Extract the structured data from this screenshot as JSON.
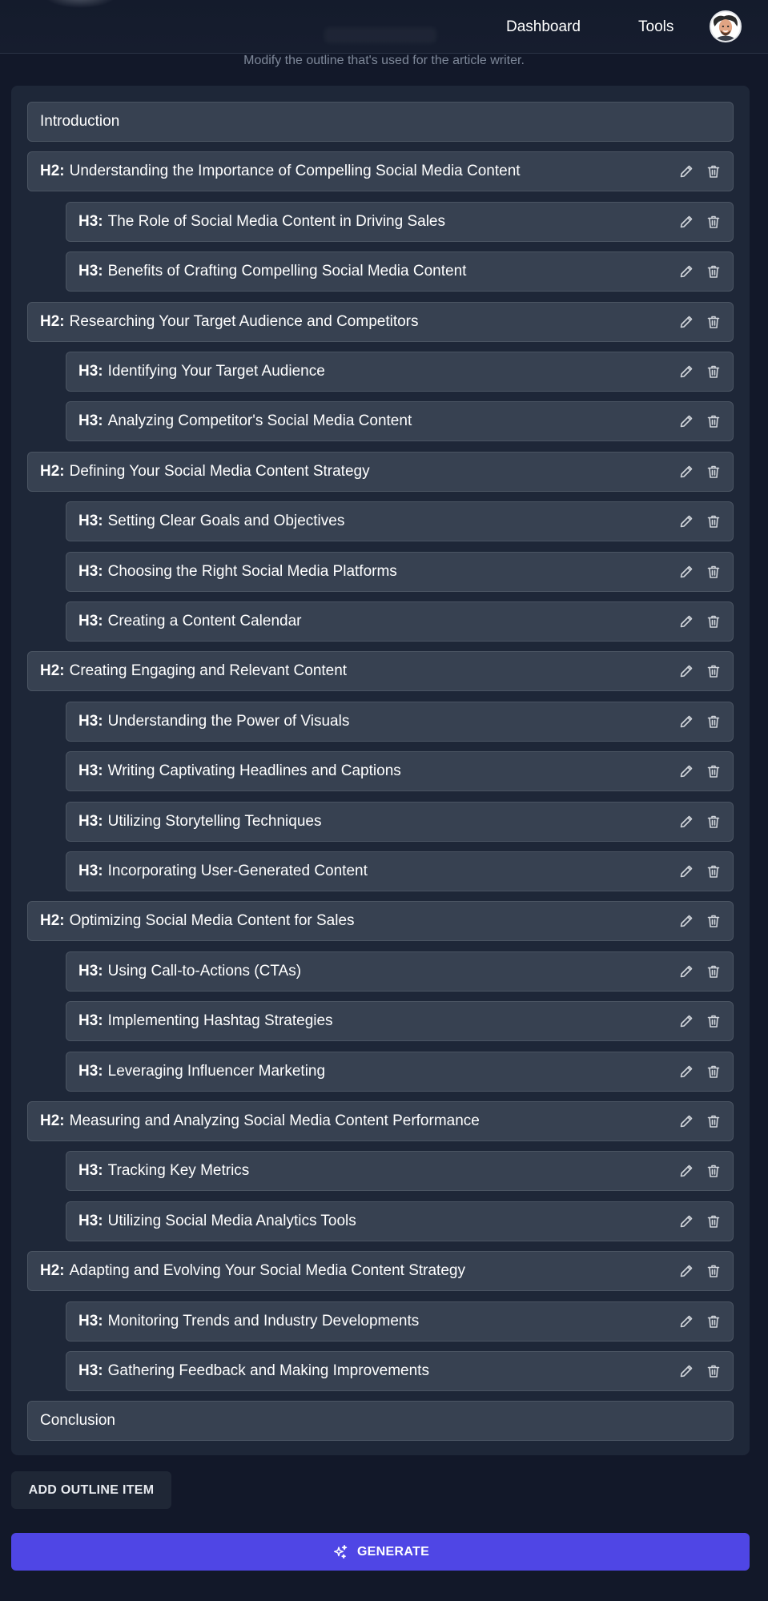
{
  "nav": {
    "dashboard_label": "Dashboard",
    "tools_label": "Tools"
  },
  "page": {
    "subtitle": "Modify the outline that's used for the article writer."
  },
  "outline": [
    {
      "level": "plain",
      "tag": "",
      "text": "Introduction"
    },
    {
      "level": "h2",
      "tag": "H2:",
      "text": "Understanding the Importance of Compelling Social Media Content"
    },
    {
      "level": "h3",
      "tag": "H3:",
      "text": "The Role of Social Media Content in Driving Sales"
    },
    {
      "level": "h3",
      "tag": "H3:",
      "text": "Benefits of Crafting Compelling Social Media Content"
    },
    {
      "level": "h2",
      "tag": "H2:",
      "text": "Researching Your Target Audience and Competitors"
    },
    {
      "level": "h3",
      "tag": "H3:",
      "text": "Identifying Your Target Audience"
    },
    {
      "level": "h3",
      "tag": "H3:",
      "text": "Analyzing Competitor's Social Media Content"
    },
    {
      "level": "h2",
      "tag": "H2:",
      "text": "Defining Your Social Media Content Strategy"
    },
    {
      "level": "h3",
      "tag": "H3:",
      "text": "Setting Clear Goals and Objectives"
    },
    {
      "level": "h3",
      "tag": "H3:",
      "text": "Choosing the Right Social Media Platforms"
    },
    {
      "level": "h3",
      "tag": "H3:",
      "text": "Creating a Content Calendar"
    },
    {
      "level": "h2",
      "tag": "H2:",
      "text": "Creating Engaging and Relevant Content"
    },
    {
      "level": "h3",
      "tag": "H3:",
      "text": "Understanding the Power of Visuals"
    },
    {
      "level": "h3",
      "tag": "H3:",
      "text": "Writing Captivating Headlines and Captions"
    },
    {
      "level": "h3",
      "tag": "H3:",
      "text": "Utilizing Storytelling Techniques"
    },
    {
      "level": "h3",
      "tag": "H3:",
      "text": "Incorporating User-Generated Content"
    },
    {
      "level": "h2",
      "tag": "H2:",
      "text": "Optimizing Social Media Content for Sales"
    },
    {
      "level": "h3",
      "tag": "H3:",
      "text": "Using Call-to-Actions (CTAs)"
    },
    {
      "level": "h3",
      "tag": "H3:",
      "text": "Implementing Hashtag Strategies"
    },
    {
      "level": "h3",
      "tag": "H3:",
      "text": "Leveraging Influencer Marketing"
    },
    {
      "level": "h2",
      "tag": "H2:",
      "text": "Measuring and Analyzing Social Media Content Performance"
    },
    {
      "level": "h3",
      "tag": "H3:",
      "text": "Tracking Key Metrics"
    },
    {
      "level": "h3",
      "tag": "H3:",
      "text": "Utilizing Social Media Analytics Tools"
    },
    {
      "level": "h2",
      "tag": "H2:",
      "text": "Adapting and Evolving Your Social Media Content Strategy"
    },
    {
      "level": "h3",
      "tag": "H3:",
      "text": "Monitoring Trends and Industry Developments"
    },
    {
      "level": "h3",
      "tag": "H3:",
      "text": "Gathering Feedback and Making Improvements"
    },
    {
      "level": "plain",
      "tag": "",
      "text": "Conclusion"
    }
  ],
  "actions": {
    "add_label": "ADD OUTLINE ITEM",
    "generate_label": "GENERATE"
  },
  "icons": {
    "edit": "pencil-icon",
    "delete": "trash-icon",
    "generate": "sparkles-icon"
  },
  "colors": {
    "background": "#121829",
    "panel": "#1e2738",
    "row": "#374151",
    "accent": "#4f46e5"
  }
}
